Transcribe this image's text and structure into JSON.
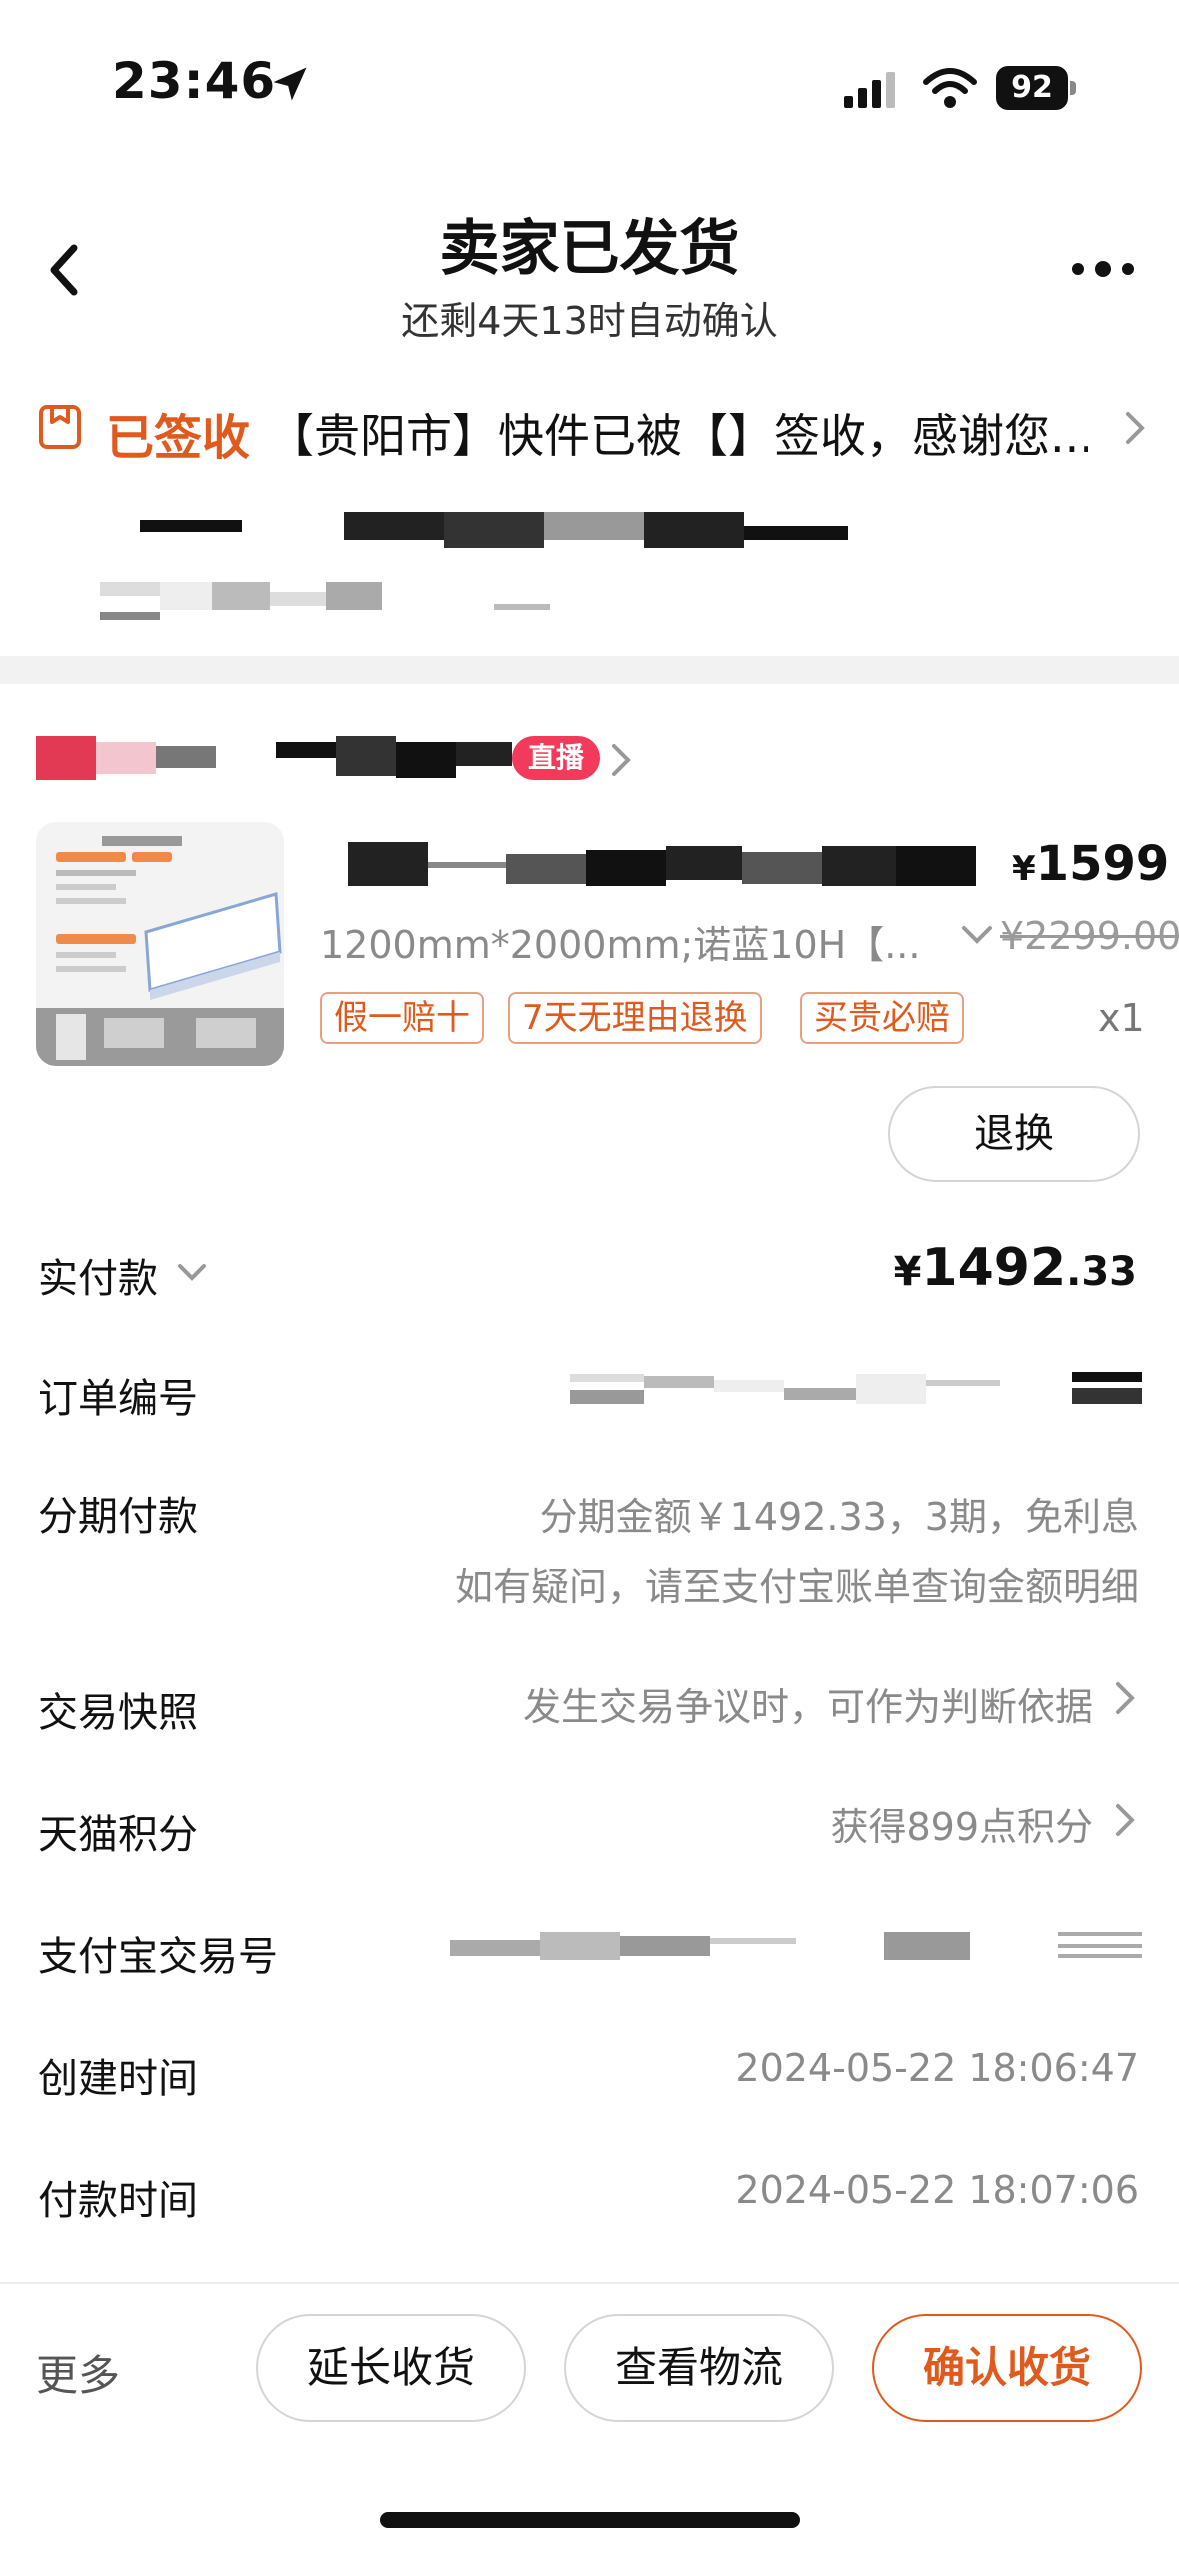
{
  "status_bar": {
    "time": "23:46",
    "battery": "92"
  },
  "nav": {
    "title": "卖家已发货",
    "subtitle": "还剩4天13时自动确认"
  },
  "logistics": {
    "status": "已签收",
    "text": "【贵阳市】快件已被【】签收，感谢您..."
  },
  "shop": {
    "live_badge": "直播"
  },
  "product": {
    "price_symbol": "¥",
    "price": "1599",
    "spec": "1200mm*2000mm;诺蓝10H【...",
    "orig_price": "¥2299.00",
    "tags": [
      "假一赔十",
      "7天无理由退换",
      "买贵必赔"
    ],
    "qty": "x1",
    "refund_button": "退换"
  },
  "payment": {
    "label": "实付款",
    "symbol": "¥",
    "amount_int": "1492",
    "amount_dec": ".33"
  },
  "order_info": [
    {
      "label": "订单编号",
      "value": ""
    },
    {
      "label": "分期付款",
      "value": "分期金额￥1492.33，3期，免利息",
      "value2": "如有疑问，请至支付宝账单查询金额明细"
    },
    {
      "label": "交易快照",
      "value": "发生交易争议时，可作为判断依据"
    },
    {
      "label": "天猫积分",
      "value": "获得899点积分"
    },
    {
      "label": "支付宝交易号",
      "value": ""
    },
    {
      "label": "创建时间",
      "value": "2024-05-22 18:06:47"
    },
    {
      "label": "付款时间",
      "value": "2024-05-22 18:07:06"
    }
  ],
  "bottom_bar": {
    "more": "更多",
    "extend": "延长收货",
    "logistics": "查看物流",
    "confirm": "确认收货"
  },
  "colors": {
    "accent": "#e05a1e",
    "live": "#f23a5b"
  }
}
